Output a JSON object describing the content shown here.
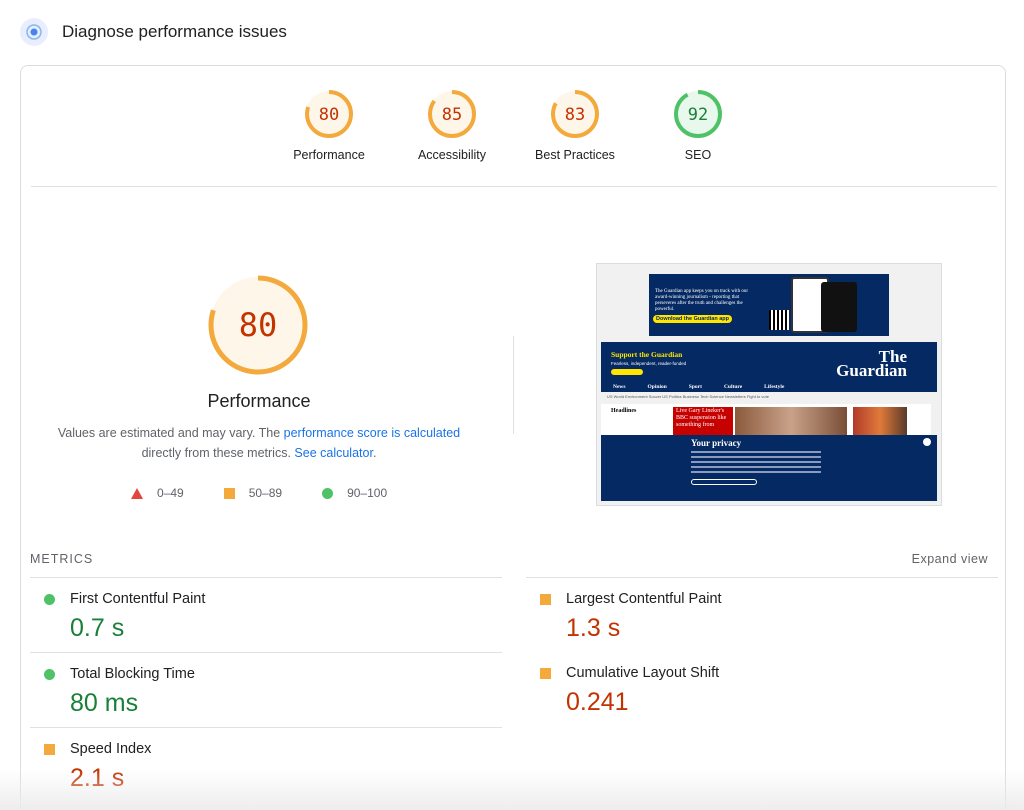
{
  "header": {
    "title": "Diagnose performance issues"
  },
  "gauges": [
    {
      "label": "Performance",
      "score": "80",
      "value": 0.8,
      "status": "average"
    },
    {
      "label": "Accessibility",
      "score": "85",
      "value": 0.85,
      "status": "average"
    },
    {
      "label": "Best Practices",
      "score": "83",
      "value": 0.83,
      "status": "average"
    },
    {
      "label": "SEO",
      "score": "92",
      "value": 0.92,
      "status": "good"
    }
  ],
  "main": {
    "score": "80",
    "score_value": 0.8,
    "title": "Performance",
    "desc_prefix": "Values are estimated and may vary. The ",
    "desc_link1": "performance score is calculated",
    "desc_mid": "directly from these metrics. ",
    "desc_link2": "See calculator",
    "desc_suffix": "."
  },
  "legend": [
    {
      "symbol": "triangle",
      "range": "0–49"
    },
    {
      "symbol": "square",
      "range": "50–89"
    },
    {
      "symbol": "circle",
      "range": "90–100"
    }
  ],
  "screenshot": {
    "ad_text": "The Guardian app keeps you on track with our award-winning journalism - reporting that perseveres after the truth and challenges the powerful.",
    "ad_button": "Download the Guardian app",
    "support": "Support the Guardian",
    "support_sub": "Fearless, independent, reader-funded",
    "logo_line1": "The",
    "logo_line2": "Guardian",
    "nav": [
      "News",
      "Opinion",
      "Sport",
      "Culture",
      "Lifestyle"
    ],
    "subnav": "US  World  Environment  Soccer  US Politics  Business  Tech  Science  Newsletters  Fight to vote",
    "headlines": "Headlines",
    "live": "Live Gary Lineker's BBC suspension like something from",
    "privacy_title": "Your privacy"
  },
  "metrics_section": {
    "title": "METRICS",
    "expand_label": "Expand view"
  },
  "metrics": [
    {
      "name": "First Contentful Paint",
      "value": "0.7 s",
      "status": "good"
    },
    {
      "name": "Largest Contentful Paint",
      "value": "1.3 s",
      "status": "average"
    },
    {
      "name": "Total Blocking Time",
      "value": "80 ms",
      "status": "good"
    },
    {
      "name": "Cumulative Layout Shift",
      "value": "0.241",
      "status": "average"
    },
    {
      "name": "Speed Index",
      "value": "2.1 s",
      "status": "average"
    }
  ],
  "colors": {
    "average": "#f3a93c",
    "average_text": "#c33300",
    "average_bg": "#fff6ea",
    "good": "#4fc167",
    "good_text": "#188038",
    "good_bg": "#e8f8ec",
    "poor": "#e2463c",
    "link": "#1a73e8"
  }
}
